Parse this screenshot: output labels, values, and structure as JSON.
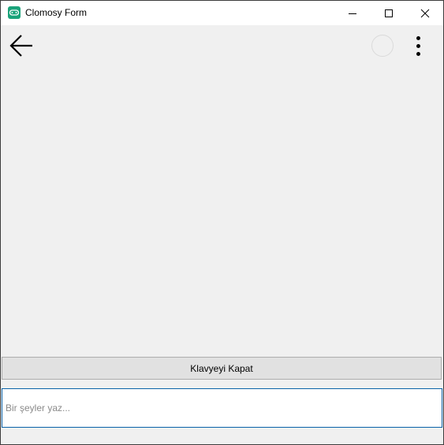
{
  "window": {
    "title": "Clomosy Form",
    "icon": "clomosy-app-icon"
  },
  "titlebar_buttons": {
    "minimize": "minimize-icon",
    "maximize": "maximize-icon",
    "close": "close-icon"
  },
  "toolbar": {
    "back_icon": "arrow-left-icon",
    "loading_icon": "spinner-icon",
    "more_icon": "more-vertical-icon"
  },
  "keyboard": {
    "close_label": "Klavyeyi Kapat"
  },
  "input": {
    "placeholder": "Bir şeyler yaz...",
    "value": ""
  },
  "colors": {
    "background": "#f0f0f0",
    "button_face": "#e1e1e1",
    "input_border": "#0a62a8",
    "app_icon": "#1aa37a"
  }
}
